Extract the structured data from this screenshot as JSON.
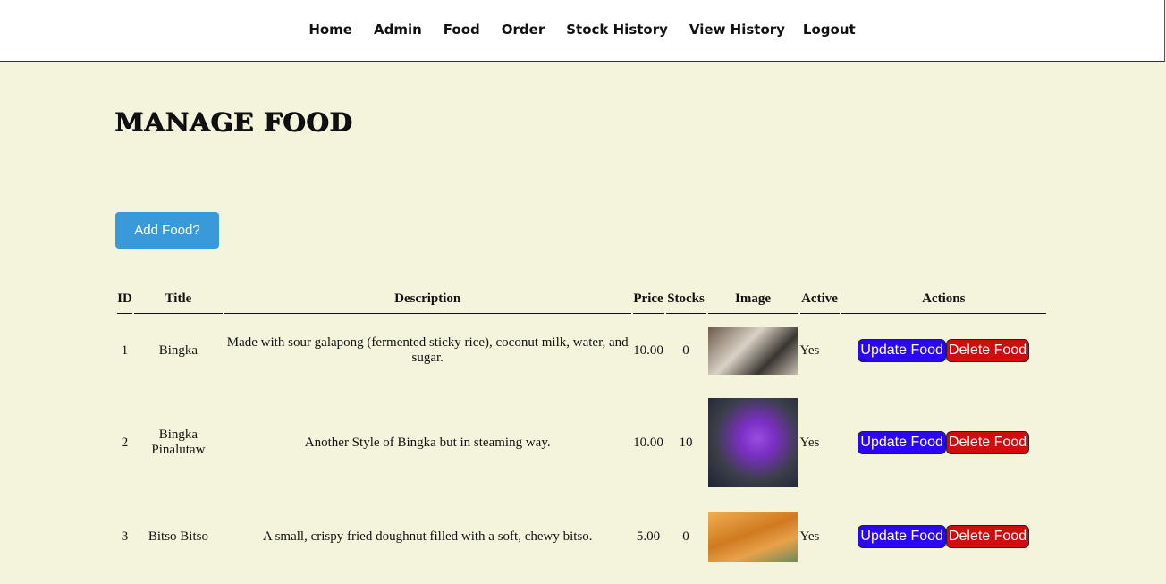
{
  "nav": {
    "items": [
      "Home",
      "Admin",
      "Food",
      "Order",
      "Stock History",
      "View History",
      "Logout"
    ]
  },
  "page": {
    "title": "MANAGE FOOD",
    "add_button": "Add Food?"
  },
  "table": {
    "headers": [
      "ID",
      "Title",
      "Description",
      "Price",
      "Stocks",
      "Image",
      "Active",
      "Actions"
    ],
    "rows": [
      {
        "id": "1",
        "title": "Bingka",
        "description": "Made with sour galapong (fermented sticky rice), coconut milk, water, and sugar.",
        "price": "10.00",
        "stocks": "0",
        "active": "Yes",
        "update": "Update Food",
        "delete": "Delete Food"
      },
      {
        "id": "2",
        "title": "Bingka Pinalutaw",
        "description": "Another Style of Bingka but in steaming way.",
        "price": "10.00",
        "stocks": "10",
        "active": "Yes",
        "update": "Update Food",
        "delete": "Delete Food"
      },
      {
        "id": "3",
        "title": "Bitso Bitso",
        "description": "A small, crispy fried doughnut filled with a soft, chewy bitso.",
        "price": "5.00",
        "stocks": "0",
        "active": "Yes",
        "update": "Update Food",
        "delete": "Delete Food"
      }
    ]
  },
  "colors": {
    "background": "#f4f4dc",
    "add_button": "#3a9ad9",
    "update_button": "#2a06f2",
    "delete_button": "#d00d0d"
  }
}
